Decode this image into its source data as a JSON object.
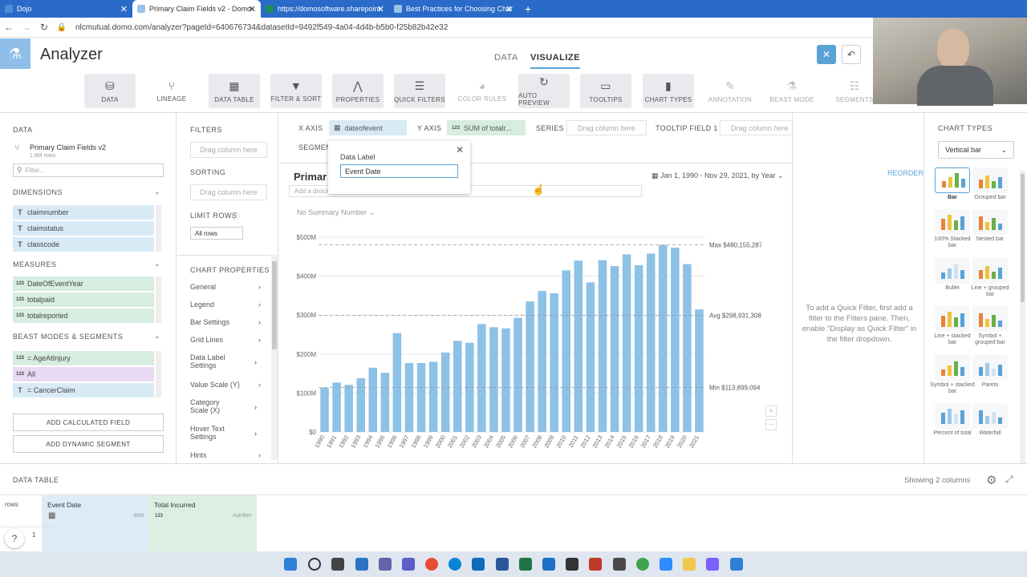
{
  "browser": {
    "tabs": [
      {
        "label": "Dojo",
        "color": "#4a90d9"
      },
      {
        "label": "Primary Claim Fields v2 - Domo",
        "color": "#99c2e8"
      },
      {
        "label": "https://domosoftware.sharepoint",
        "color": "#1a8f5a"
      },
      {
        "label": "Best Practices for Choosing Char",
        "color": "#99c2e8"
      }
    ],
    "new_tab": "+",
    "url": "nlcmutual.domo.com/analyzer?pageId=640676734&datasetId=9492f549-4a04-4d4b-b5b0-f25b82b42e32"
  },
  "header": {
    "title": "Analyzer",
    "tab_data": "DATA",
    "tab_visualize": "VISUALIZE"
  },
  "toolbar": [
    {
      "label": "DATA",
      "icon": "database-icon",
      "glyph": "⛁"
    },
    {
      "label": "LINEAGE",
      "icon": "lineage-icon",
      "glyph": "⑂"
    },
    {
      "label": "DATA TABLE",
      "icon": "table-icon",
      "glyph": "▦"
    },
    {
      "label": "FILTER & SORT",
      "icon": "filter-icon",
      "glyph": "▼"
    },
    {
      "label": "PROPERTIES",
      "icon": "properties-icon",
      "glyph": "⋀"
    },
    {
      "label": "QUICK FILTERS",
      "icon": "quick-filter-icon",
      "glyph": "☰"
    },
    {
      "label": "COLOR RULES",
      "icon": "palette-icon",
      "glyph": "◕"
    },
    {
      "label": "AUTO PREVIEW",
      "icon": "refresh-icon",
      "glyph": "↻"
    },
    {
      "label": "TOOLTIPS",
      "icon": "tooltip-icon",
      "glyph": "▭"
    },
    {
      "label": "CHART TYPES",
      "icon": "bar-chart-icon",
      "glyph": "▮"
    },
    {
      "label": "ANNOTATION",
      "icon": "pen-icon",
      "glyph": "✎"
    },
    {
      "label": "BEAST MODE",
      "icon": "beast-mode-icon",
      "glyph": "⚗"
    },
    {
      "label": "SEGMENTS",
      "icon": "segments-icon",
      "glyph": "☷"
    }
  ],
  "data_panel": {
    "heading": "DATA",
    "dataset_name": "Primary Claim Fields v2",
    "dataset_rows": "1.8M rows",
    "filter_placeholder": "Filter...",
    "dimensions_heading": "DIMENSIONS",
    "dimensions": [
      "claimnumber",
      "claimstatus",
      "classcode"
    ],
    "measures_heading": "MEASURES",
    "measures": [
      "DateOfEventYear",
      "totalpaid",
      "totalreported"
    ],
    "beast_heading": "BEAST MODES & SEGMENTS",
    "beast_modes": [
      {
        "label": "= AgeAtInjury",
        "type": "123"
      },
      {
        "label": "All",
        "type": "123"
      },
      {
        "label": "= CancerClaim",
        "type": "T"
      }
    ],
    "add_calculated": "ADD CALCULATED FIELD",
    "add_segment": "ADD DYNAMIC SEGMENT"
  },
  "filter_panel": {
    "filters_heading": "FILTERS",
    "drag_here": "Drag column here",
    "sorting_heading": "SORTING",
    "limit_heading": "LIMIT ROWS",
    "limit_value": "All rows",
    "chart_properties_heading": "CHART PROPERTIES",
    "properties": [
      "General",
      "Legend",
      "Bar Settings",
      "Grid Lines",
      "Data Label Settings",
      "Value Scale (Y)",
      "Category Scale (X)",
      "Hover Text Settings",
      "Hints"
    ]
  },
  "dropzones": {
    "x_axis_label": "X AXIS",
    "x_axis_value": "dateofevent",
    "y_axis_label": "Y AXIS",
    "y_axis_value": "SUM of totalr...",
    "series_label": "SERIES",
    "series_placeholder": "Drag column here",
    "tooltip_label": "TOOLTIP FIELD 1",
    "tooltip_placeholder": "Drag column here",
    "segments_label": "SEGMEN"
  },
  "popup": {
    "label": "Data Label",
    "value": "Event Date"
  },
  "chart_header": {
    "title": "Primar",
    "description_placeholder": "Add a descr",
    "date_range": "Jan 1, 1990 - Nov 29, 2021, by Year",
    "summary": "No Summary Number",
    "reorder": "REORDER"
  },
  "chart_data": {
    "type": "bar",
    "categories": [
      "1990",
      "1991",
      "1992",
      "1993",
      "1994",
      "1995",
      "1996",
      "1997",
      "1998",
      "1999",
      "2000",
      "2001",
      "2002",
      "2003",
      "2004",
      "2005",
      "2006",
      "2007",
      "2008",
      "2009",
      "2010",
      "2011",
      "2012",
      "2013",
      "2014",
      "2015",
      "2016",
      "2017",
      "2018",
      "2019",
      "2020",
      "2021"
    ],
    "values": [
      114,
      127,
      121,
      138,
      165,
      152,
      254,
      177,
      177,
      180,
      204,
      234,
      229,
      277,
      269,
      266,
      293,
      335,
      362,
      356,
      415,
      440,
      384,
      441,
      426,
      456,
      428,
      458,
      480,
      473,
      431,
      315
    ],
    "units": "$M",
    "ylim": [
      0,
      500
    ],
    "yticks": [
      "$0",
      "$100M",
      "$200M",
      "$300M",
      "$400M",
      "$500M"
    ],
    "bar_color": "#8ec1e6",
    "reference_lines": [
      {
        "label": "Max $480,155,287",
        "value": 480.155
      },
      {
        "label": "Avg $298,931,308",
        "value": 298.931
      },
      {
        "label": "Min $113,899,094",
        "value": 113.899
      }
    ],
    "grid": true
  },
  "quick_filter_hint": "To add a Quick Filter, first add a filter to the Filters pane. Then, enable \"Display as Quick Filter\" in the filter dropdown.",
  "chart_types_panel": {
    "heading": "CHART TYPES",
    "selected": "Vertical bar",
    "types": [
      "Bar",
      "Grouped bar",
      "100% Stacked bar",
      "Nested bar",
      "Bullet",
      "Line + grouped bar",
      "Line + stacked bar",
      "Symbol + grouped bar",
      "Symbol + stacked bar",
      "Pareto",
      "Percent of total",
      "Waterfall"
    ]
  },
  "data_table": {
    "heading": "DATA TABLE",
    "showing": "Showing 2 columns",
    "rows_label": "rows",
    "columns": [
      {
        "name": "Event Date",
        "type": "date"
      },
      {
        "name": "Total Incurred",
        "type": "number",
        "badge": "123"
      }
    ],
    "row_number": "1"
  },
  "colors": {
    "accent": "#5aa2d6",
    "dimension": "#d8eaf5",
    "measure": "#d6ede0",
    "beast": "#ead9f3"
  }
}
